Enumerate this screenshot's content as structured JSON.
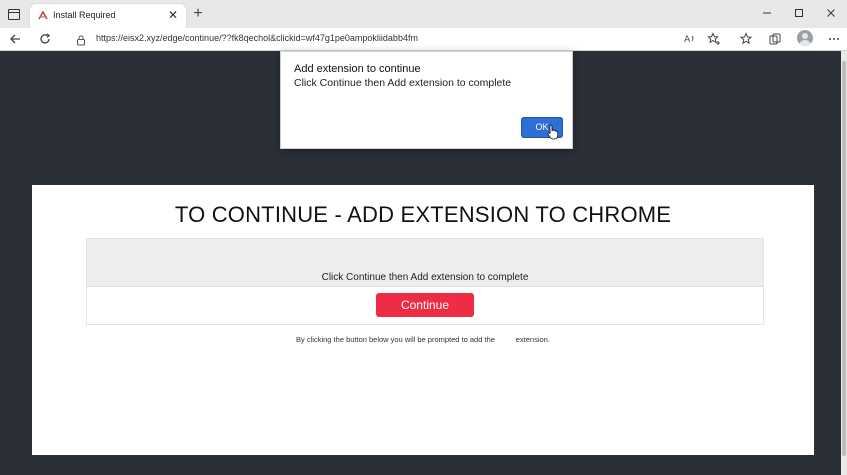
{
  "browser": {
    "tab": {
      "title": "Install Required"
    },
    "address_bar": {
      "url": "https://eisx2.xyz/edge/continue/??fk8qechol&clickid=wf47g1pe0ampokliidabb4fm"
    },
    "icons": {
      "back": "back-arrow-icon",
      "refresh": "refresh-icon",
      "lock": "lock-icon",
      "read_aloud": "read-aloud-icon",
      "add_favorite": "add-favorite-icon",
      "favorites": "favorites-icon",
      "collections": "collections-icon",
      "profile": "profile-avatar-icon",
      "more": "more-options-icon"
    }
  },
  "dialog": {
    "title": "Add extension to continue",
    "message": "Click Continue then Add extension to complete",
    "ok_label": "OK"
  },
  "page": {
    "heading": "TO CONTINUE - ADD EXTENSION TO CHROME",
    "instruction": "Click Continue then Add extension to complete",
    "continue_label": "Continue",
    "fineprint": "By clicking the button below you will be prompted to add the          extension."
  },
  "colors": {
    "page_background": "#2b2f38",
    "continue_button": "#ee2c45",
    "ok_button": "#2d6fd6"
  }
}
